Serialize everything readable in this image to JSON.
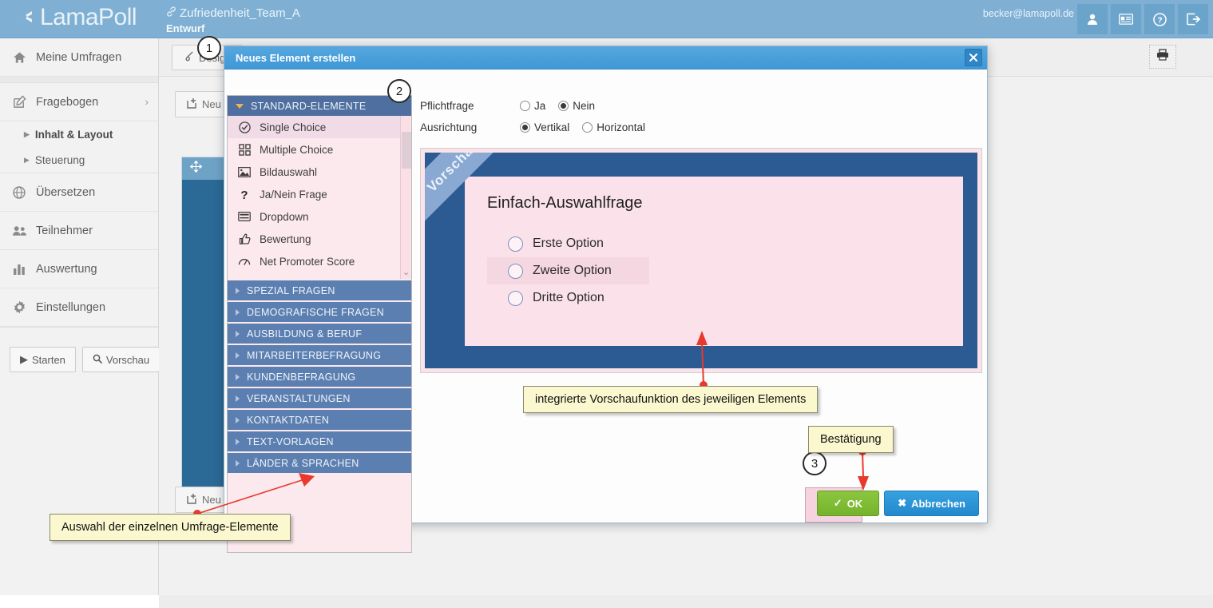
{
  "header": {
    "brand": "LamaPoll",
    "survey_name": "Zufriedenheit_Team_A",
    "survey_state": "Entwurf",
    "user_email": "becker@lamapoll.de",
    "icons": [
      {
        "name": "user-icon",
        "label": "Benutzer"
      },
      {
        "name": "id-card-icon",
        "label": "Konto"
      },
      {
        "name": "help-icon",
        "label": "Hilfe"
      },
      {
        "name": "logout-icon",
        "label": "Abmelden"
      }
    ]
  },
  "sidebar": {
    "items": [
      {
        "label": "Meine Umfragen",
        "icon": "home-icon"
      },
      {
        "label": "Fragebogen",
        "icon": "edit-icon",
        "expandable": true
      },
      {
        "label": "Übersetzen",
        "icon": "globe-icon"
      },
      {
        "label": "Teilnehmer",
        "icon": "users-icon"
      },
      {
        "label": "Auswertung",
        "icon": "bar-chart-icon"
      },
      {
        "label": "Einstellungen",
        "icon": "gear-icon"
      }
    ],
    "sub_items": [
      {
        "label": "Inhalt & Layout",
        "active": true
      },
      {
        "label": "Steuerung",
        "active": false
      }
    ],
    "buttons": [
      {
        "label": "Starten",
        "icon": "play-icon"
      },
      {
        "label": "Vorschau",
        "icon": "magnifier-icon"
      }
    ]
  },
  "background": {
    "design_button": "Design",
    "new_button_top": "Neu",
    "new_button_bottom": "Neu",
    "print_icon": "printer-icon"
  },
  "modal": {
    "title": "Neues Element erstellen",
    "close_label": "✖",
    "options": {
      "required_label": "Pflichtfrage",
      "required_yes": "Ja",
      "required_no": "Nein",
      "required_value": "Nein",
      "orientation_label": "Ausrichtung",
      "orientation_vertical": "Vertikal",
      "orientation_horizontal": "Horizontal",
      "orientation_value": "Vertikal"
    },
    "chooser": {
      "open_category": "STANDARD-ELEMENTE",
      "elements": [
        {
          "label": "Single Choice",
          "icon": "check-circle-icon",
          "selected": true
        },
        {
          "label": "Multiple Choice",
          "icon": "grid-squares-icon",
          "selected": false
        },
        {
          "label": "Bildauswahl",
          "icon": "image-icon",
          "selected": false
        },
        {
          "label": "Ja/Nein Frage",
          "icon": "question-mark-icon",
          "selected": false
        },
        {
          "label": "Dropdown",
          "icon": "dropdown-icon",
          "selected": false
        },
        {
          "label": "Bewertung",
          "icon": "thumbs-up-icon",
          "selected": false
        },
        {
          "label": "Net Promoter Score",
          "icon": "gauge-icon",
          "selected": false
        }
      ],
      "categories": [
        "SPEZIAL FRAGEN",
        "DEMOGRAFISCHE FRAGEN",
        "AUSBILDUNG & BERUF",
        "MITARBEITERBEFRAGUNG",
        "KUNDENBEFRAGUNG",
        "VERANSTALTUNGEN",
        "KONTAKTDATEN",
        "TEXT-VORLAGEN",
        "LÄNDER & SPRACHEN"
      ]
    },
    "preview": {
      "ribbon": "Vorschau",
      "question_title": "Einfach-Auswahlfrage",
      "options": [
        "Erste Option",
        "Zweite Option",
        "Dritte Option"
      ],
      "hovered_option": "Zweite Option"
    },
    "footer": {
      "ok_label": "OK",
      "cancel_label": "Abbrechen"
    }
  },
  "annotations": {
    "markers": [
      "1",
      "2",
      "3"
    ],
    "callouts": [
      {
        "id": "preview",
        "text": "integrierte Vorschaufunktion des jeweiligen Elements"
      },
      {
        "id": "confirm",
        "text": "Bestätigung"
      },
      {
        "id": "selection",
        "text": "Auswahl der einzelnen Umfrage-Elemente"
      }
    ],
    "accent_color": "#e8392c"
  }
}
